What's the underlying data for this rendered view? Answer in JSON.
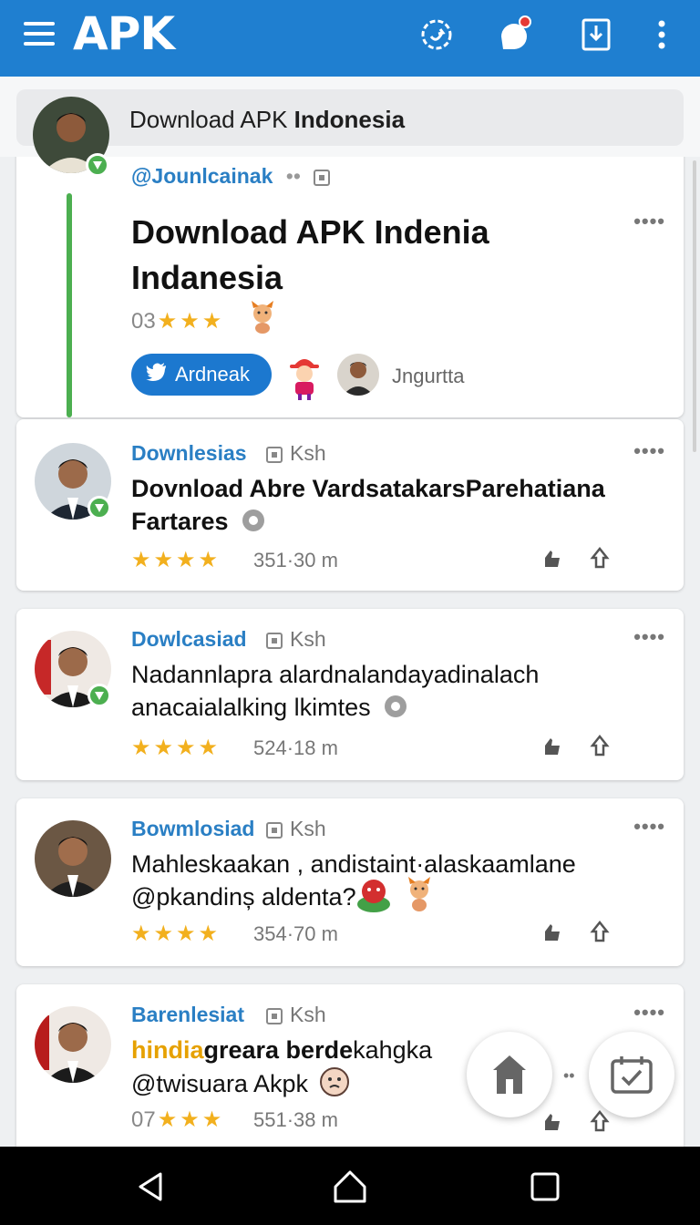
{
  "app": {
    "logo": "APK"
  },
  "colors": {
    "primary": "#1f7fd0",
    "accent_green": "#4caf50",
    "link_blue": "#2a7fc4",
    "star": "#f2b01e"
  },
  "toolbar": {
    "icons": [
      "menu-icon",
      "sync-icon",
      "notification-icon",
      "download-icon",
      "more-icon"
    ]
  },
  "search": {
    "prefix": "Download APK ",
    "bold": "Indonesia"
  },
  "featured": {
    "user": "@Jounlcainak",
    "title": "Download APK Indenia Indanesia",
    "rating_num": "03",
    "stars": "★★★",
    "button_label": "Ardneak",
    "follower_name": "Jngurtta"
  },
  "posts": [
    {
      "user": "Downlesias",
      "tag": "Ksh",
      "text": "Dovnload Abre VardsatakarsParehatiana Fartares",
      "stars": "★★★★",
      "count": "351·30 m",
      "bold": true
    },
    {
      "user": "Dowlcasiad",
      "tag": "Ksh",
      "text": "Nadannlapra alardnalandayadinalach anacaialalking lkimtes",
      "stars": "★★★★",
      "count": "524·18 m",
      "bold": false
    },
    {
      "user": "Bowmlosiad",
      "tag": "Ksh",
      "text": "Mahleskaakan , andistaint·alaskaamlane @pkandinș aldenta?",
      "stars": "★★★★",
      "count": "354·70 m",
      "bold": false
    },
    {
      "user": "Barenlesiat",
      "tag": "Ksh",
      "text_orange": "hindia",
      "text_bold": "greara berde",
      "text_rest": "kahgka",
      "text_line2": "@twisuara Akpk",
      "rating_num": "07",
      "stars": "★★★",
      "count": "551·38 m"
    }
  ],
  "more_dots": "••••",
  "fab_dots": "••"
}
